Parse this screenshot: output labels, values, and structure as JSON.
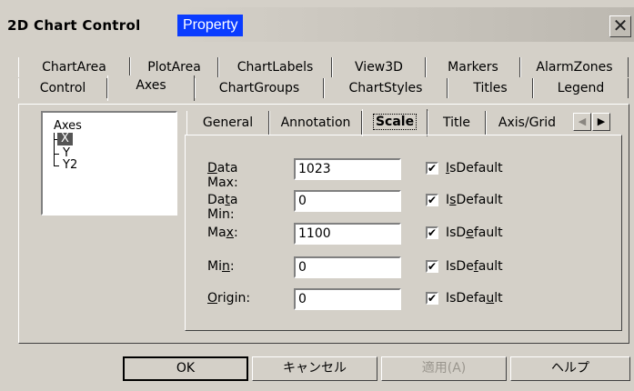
{
  "window": {
    "title": "2D Chart Control",
    "title_highlight": "Property",
    "close_glyph": "✕"
  },
  "tabs_row1": [
    "ChartArea",
    "PlotArea",
    "ChartLabels",
    "View3D",
    "Markers",
    "AlarmZones"
  ],
  "tabs_row2": [
    "Control",
    "Axes",
    "ChartGroups",
    "ChartStyles",
    "Titles",
    "Legend"
  ],
  "tree": {
    "root": "Axes",
    "children": [
      "X",
      "Y",
      "Y2"
    ],
    "selected": "X"
  },
  "subtabs": [
    "General",
    "Annotation",
    "Scale",
    "Title",
    "Axis/Grid"
  ],
  "active_subtab": "Scale",
  "scale_fields": [
    {
      "label_pre": "",
      "label_key": "D",
      "label_post": "ata Max:",
      "value": "1023",
      "checkbox_checked": true,
      "chk_pre": "",
      "chk_key": "I",
      "chk_post": "sDefault"
    },
    {
      "label_pre": "Da",
      "label_key": "t",
      "label_post": "a Min:",
      "value": "0",
      "checkbox_checked": true,
      "chk_pre": "I",
      "chk_key": "s",
      "chk_post": "Default"
    },
    {
      "label_pre": "Ma",
      "label_key": "x",
      "label_post": ":",
      "value": "1100",
      "checkbox_checked": true,
      "chk_pre": "IsD",
      "chk_key": "e",
      "chk_post": "fault"
    },
    {
      "label_pre": "Mi",
      "label_key": "n",
      "label_post": ":",
      "value": "0",
      "checkbox_checked": true,
      "chk_pre": "IsDe",
      "chk_key": "f",
      "chk_post": "ault"
    },
    {
      "label_pre": "",
      "label_key": "O",
      "label_post": "rigin:",
      "value": "0",
      "checkbox_checked": true,
      "chk_pre": "IsDefa",
      "chk_key": "u",
      "chk_post": "lt"
    }
  ],
  "checkbox_mark": "✔",
  "buttons": {
    "ok": "OK",
    "cancel": "キャンセル",
    "apply": "適用(A)",
    "help": "ヘルプ"
  },
  "arrows": {
    "left": "◀",
    "right": "▶"
  }
}
